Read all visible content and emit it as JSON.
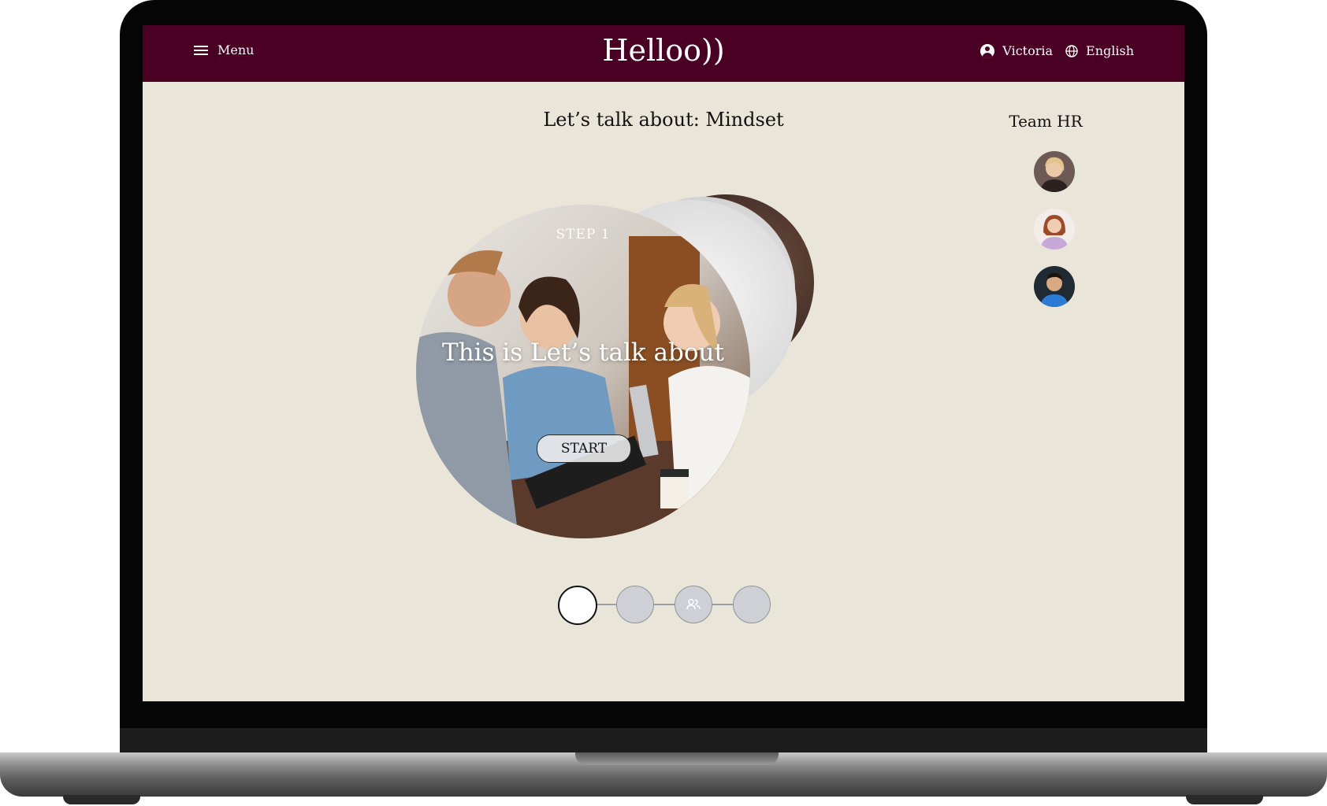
{
  "header": {
    "menu_label": "Menu",
    "logo": "Helloo))",
    "user_name": "Victoria",
    "language": "English"
  },
  "page": {
    "title": "Let’s talk about: Mindset"
  },
  "team": {
    "title": "Team HR",
    "members": [
      {
        "icon": "avatar-woman-blonde"
      },
      {
        "icon": "avatar-woman-redhead"
      },
      {
        "icon": "avatar-man-dark-hair"
      }
    ]
  },
  "card": {
    "step_label": "STEP 1",
    "heading": "This is Let’s talk about",
    "start_label": "START"
  },
  "stepper": {
    "steps": 4,
    "active_index": 0,
    "icons": [
      "",
      "",
      "people-icon",
      ""
    ]
  },
  "colors": {
    "header_bg": "#4a0022",
    "page_bg": "#e9e5d9",
    "step_inactive": "#cfd0d5"
  }
}
